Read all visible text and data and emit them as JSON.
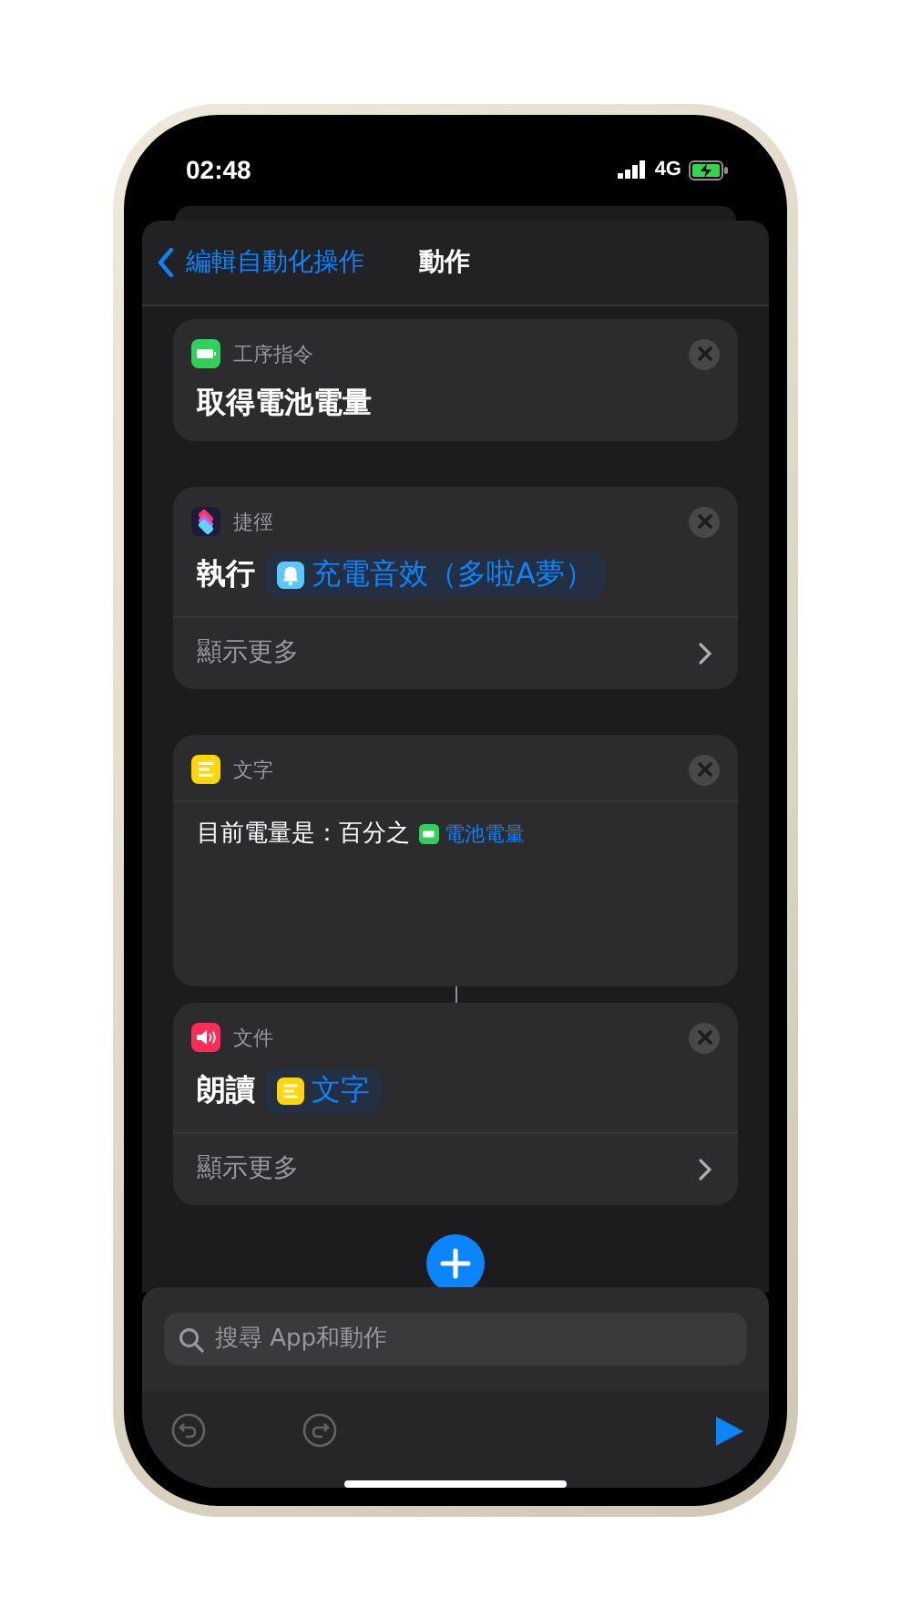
{
  "status_bar": {
    "time": "02:48",
    "network": "4G"
  },
  "nav": {
    "back_label": "編輯自動化操作",
    "title": "動作"
  },
  "actions": [
    {
      "kind": "plain",
      "app": "工序指令",
      "text": "取得電池電量"
    },
    {
      "kind": "token",
      "app": "捷徑",
      "verb": "執行",
      "token": "充電音效（多啦A夢）",
      "more": "顯示更多"
    },
    {
      "kind": "text",
      "app": "文字",
      "prefix": "目前電量是：百分之",
      "token": "電池電量"
    },
    {
      "kind": "token",
      "app": "文件",
      "verb": "朗讀",
      "token": "文字",
      "more": "顯示更多"
    }
  ],
  "search": {
    "placeholder": "搜尋 App和動作"
  }
}
